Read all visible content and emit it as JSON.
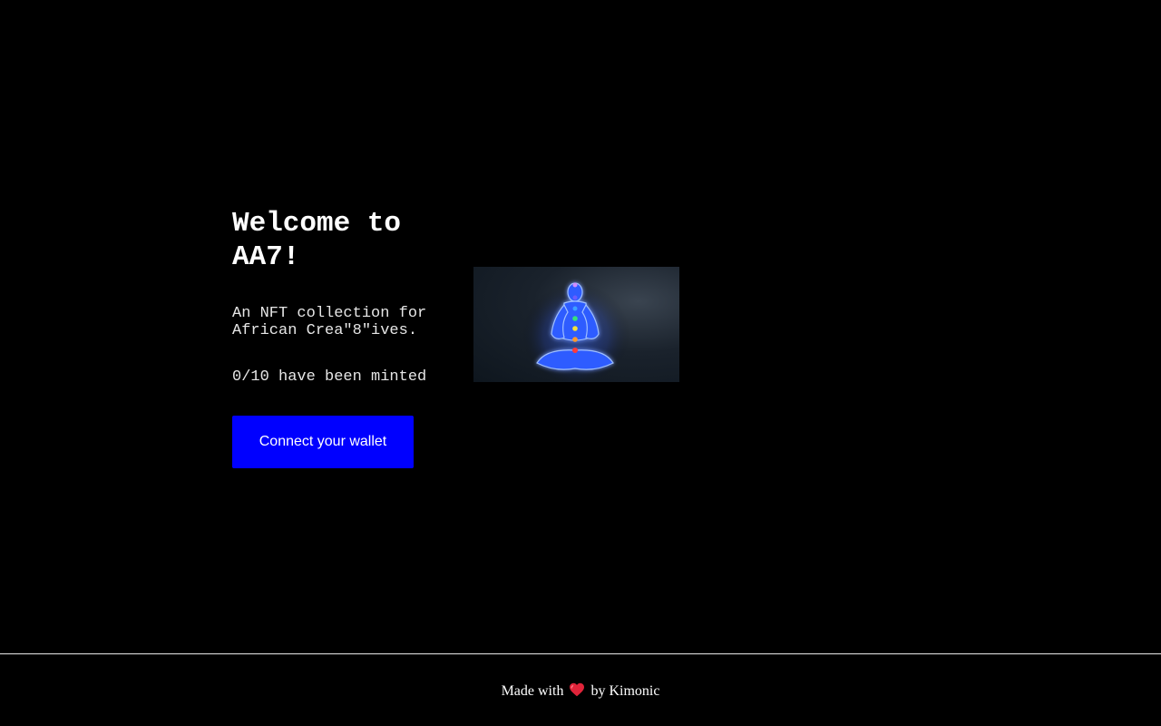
{
  "hero": {
    "title": "Welcome to AA7!",
    "subtitle": "An NFT collection for African Crea\"8\"ives.",
    "minted_status": "0/10 have been minted",
    "connect_button_label": "Connect your wallet"
  },
  "nft_image": {
    "icon": "meditating-figure-icon",
    "alt": "Glowing meditating figure with chakra points"
  },
  "footer": {
    "prefix": "Made with",
    "heart_icon": "heart-icon",
    "suffix": "by Kimonic"
  },
  "colors": {
    "background": "#000000",
    "button": "#0000ff",
    "text": "#ffffff",
    "heart": "#e0243a"
  }
}
